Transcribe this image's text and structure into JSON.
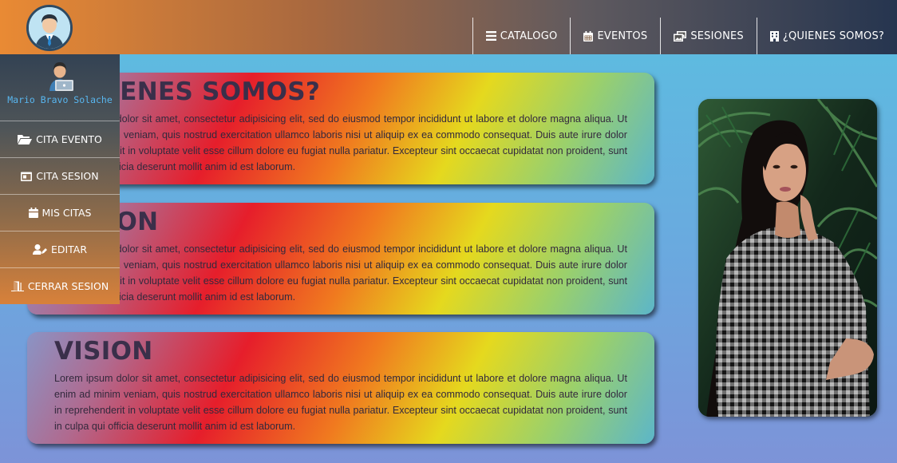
{
  "nav": {
    "items": [
      {
        "label": "CATALOGO",
        "icon": "bars-icon"
      },
      {
        "label": "EVENTOS",
        "icon": "calendar-icon"
      },
      {
        "label": "SESIONES",
        "icon": "photos-icon"
      },
      {
        "label": "¿QUIENES SOMOS?",
        "icon": "building-icon"
      }
    ]
  },
  "sidebar": {
    "user_name": "Mario Bravo Solache",
    "items": [
      {
        "label": "CITA EVENTO",
        "icon": "folder-open-icon"
      },
      {
        "label": "CITA SESION",
        "icon": "calendar-day-icon"
      },
      {
        "label": "MIS CITAS",
        "icon": "calendar-icon"
      },
      {
        "label": "EDITAR",
        "icon": "user-edit-icon"
      },
      {
        "label": "CERRAR SESION",
        "icon": "door-exit-icon"
      }
    ]
  },
  "cards": [
    {
      "title": "¿QUIENES SOMOS?",
      "text": "Lorem ipsum dolor sit amet, consectetur adipisicing elit, sed do eiusmod tempor incididunt ut labore et dolore magna aliqua. Ut enim ad minim veniam, quis nostrud exercitation ullamco laboris nisi ut aliquip ex ea commodo consequat. Duis aute irure dolor in reprehenderit in voluptate velit esse cillum dolore eu fugiat nulla pariatur. Excepteur sint occaecat cupidatat non proident, sunt in culpa qui officia deserunt mollit anim id est laborum."
    },
    {
      "title": "MISION",
      "text": "Lorem ipsum dolor sit amet, consectetur adipisicing elit, sed do eiusmod tempor incididunt ut labore et dolore magna aliqua. Ut enim ad minim veniam, quis nostrud exercitation ullamco laboris nisi ut aliquip ex ea commodo consequat. Duis aute irure dolor in reprehenderit in voluptate velit esse cillum dolore eu fugiat nulla pariatur. Excepteur sint occaecat cupidatat non proident, sunt in culpa qui officia deserunt mollit anim id est laborum."
    },
    {
      "title": "VISION",
      "text": "Lorem ipsum dolor sit amet, consectetur adipisicing elit, sed do eiusmod tempor incididunt ut labore et dolore magna aliqua. Ut enim ad minim veniam, quis nostrud exercitation ullamco laboris nisi ut aliquip ex ea commodo consequat. Duis aute irure dolor in reprehenderit in voluptate velit esse cillum dolore eu fugiat nulla pariatur. Excepteur sint occaecat cupidatat non proident, sunt in culpa qui officia deserunt mollit anim id est laborum."
    }
  ],
  "colors": {
    "background": "#5bbfe0",
    "nav_start": "#e98a34",
    "nav_end": "#26354f",
    "username": "#58b6ef",
    "card_red": "#e61e2b",
    "card_yellow": "#e5d91e"
  }
}
